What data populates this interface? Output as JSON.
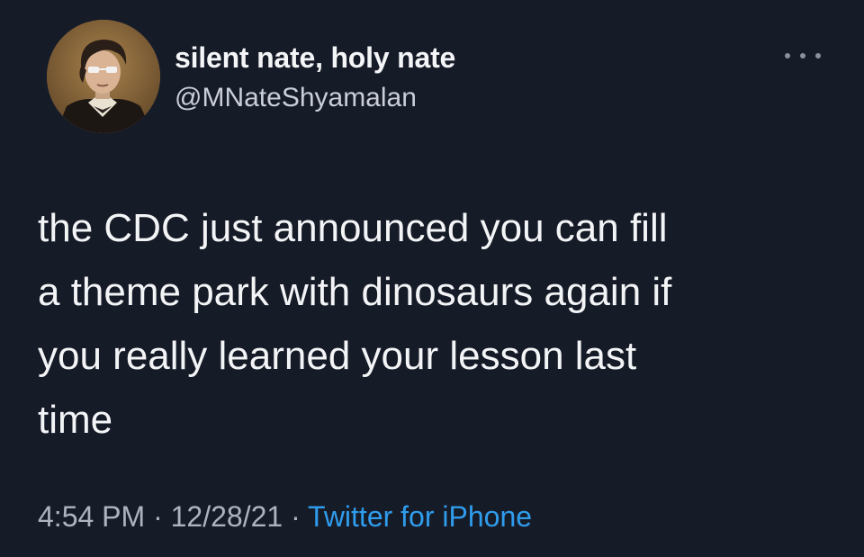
{
  "author": {
    "display_name": "silent nate, holy nate",
    "handle": "@MNateShyamalan",
    "avatar_icon": "portrait-avatar"
  },
  "menu": {
    "icon": "more-options-icon"
  },
  "tweet": {
    "text": "the CDC just announced you can fill\na theme park with dinosaurs again if\nyou really learned your lesson last\ntime"
  },
  "meta": {
    "time": "4:54 PM",
    "separator": "·",
    "date": "12/28/21",
    "source": "Twitter for iPhone"
  },
  "colors": {
    "background": "#161b28",
    "link": "#2f9cec",
    "secondary_text": "#aeb4bf"
  }
}
